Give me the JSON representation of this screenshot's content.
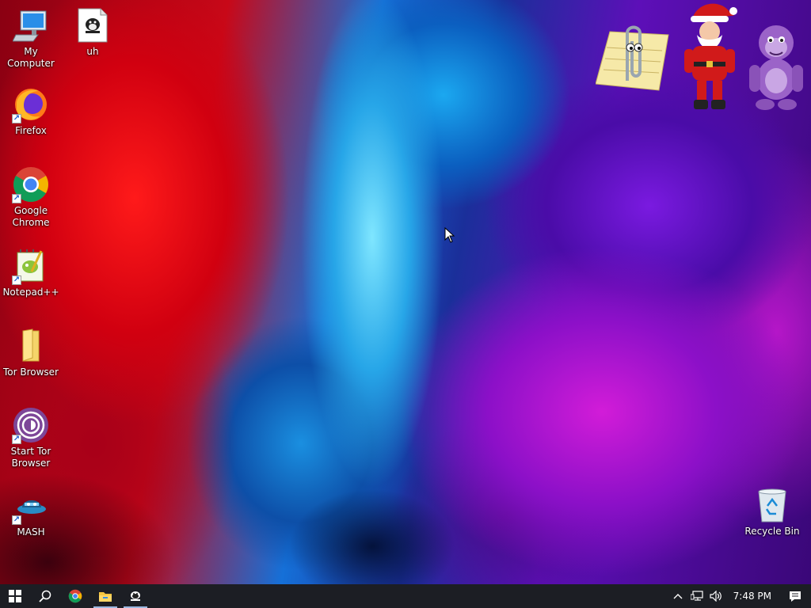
{
  "desktop_icons": [
    {
      "id": "my-computer",
      "label": "My Computer"
    },
    {
      "id": "uh",
      "label": "uh"
    },
    {
      "id": "firefox",
      "label": "Firefox"
    },
    {
      "id": "google-chrome",
      "label": "Google Chrome"
    },
    {
      "id": "notepadpp",
      "label": "Notepad++"
    },
    {
      "id": "tor-browser",
      "label": "Tor Browser"
    },
    {
      "id": "start-tor-browser",
      "label": "Start Tor Browser"
    },
    {
      "id": "mash",
      "label": "MASH"
    },
    {
      "id": "recycle-bin",
      "label": "Recycle Bin"
    }
  ],
  "desktop_agents": [
    "paperclip-assistant-icon",
    "santa-agent-icon",
    "purple-gorilla-agent-icon"
  ],
  "taskbar": {
    "pinned": [
      {
        "name": "start-button",
        "icon": "windows-logo-icon"
      },
      {
        "name": "search-button",
        "icon": "search-icon"
      },
      {
        "name": "chrome-taskbar-button",
        "icon": "chrome-icon"
      },
      {
        "name": "file-explorer-taskbar-button",
        "icon": "folder-icon"
      },
      {
        "name": "uh-taskbar-button",
        "icon": "tux-icon"
      }
    ],
    "tray": {
      "time": "7:48 PM"
    }
  },
  "colors": {
    "taskbar_bg": "#1c1e24",
    "label_text": "#ffffff"
  }
}
